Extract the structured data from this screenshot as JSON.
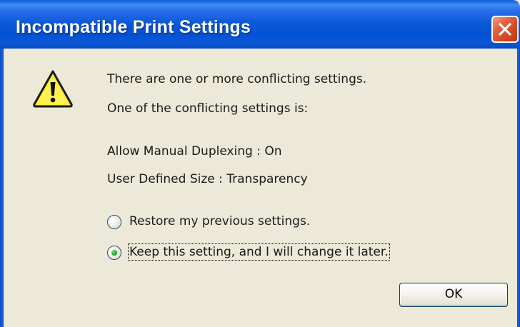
{
  "window": {
    "title": "Incompatible Print Settings"
  },
  "icons": {
    "warning": "warning-icon",
    "close": "close-icon"
  },
  "colors": {
    "titlebar": "#0a5fd8",
    "close_button": "#e4623e",
    "dialog_background": "#ece9d8",
    "warning_yellow": "#ffee33",
    "radio_dot": "#21a121"
  },
  "message": {
    "line1": "There are one or more conflicting settings.",
    "line2": "One of the conflicting settings is:",
    "setting1": "Allow Manual Duplexing : On",
    "setting2": "User Defined Size : Transparency"
  },
  "options": [
    {
      "label": "Restore my previous settings.",
      "selected": false
    },
    {
      "label": "Keep this setting, and I will change it later.",
      "selected": true
    }
  ],
  "buttons": {
    "ok_label": "OK"
  }
}
